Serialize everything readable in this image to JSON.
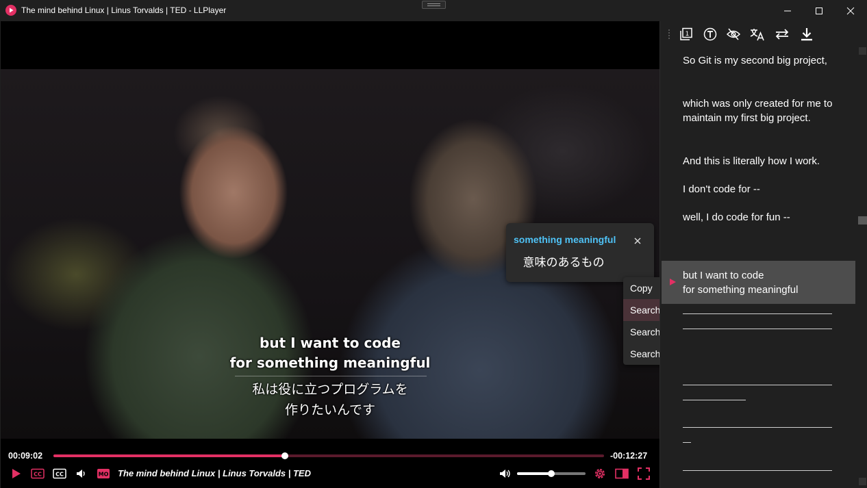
{
  "window": {
    "title": "The mind behind Linux | Linus Torvalds | TED - LLPlayer"
  },
  "subtitles_overlay": {
    "primary_line1": "but I want to code",
    "primary_line2": "for something meaningful",
    "secondary_line1": "私は役に立つプログラムを",
    "secondary_line2": "作りたいんです"
  },
  "word_popup": {
    "word": "something meaningful",
    "meaning": "意味のあるもの"
  },
  "context_menu": {
    "items": [
      "Copy",
      "Search Google",
      "Search Wiktionary",
      "Search Longman"
    ],
    "hovered": "Search Google"
  },
  "player": {
    "current_time": "00:09:02",
    "remaining_time": "-00:12:27",
    "progress": 0.421,
    "volume": 0.5,
    "media_title": "The mind behind Linux | Linus Torvalds | TED",
    "accent_color": "#e33064"
  },
  "sidebar": {
    "tools": [
      "single-subtitle-icon",
      "text-format-icon",
      "eye-off-icon",
      "translate-icon",
      "swap-icon",
      "download-icon"
    ],
    "items": [
      {
        "text": "So Git is my second big project,"
      },
      {
        "text": "which was only created for me to maintain my first big project."
      },
      {
        "text": "And this is literally how I work."
      },
      {
        "text": "I don't code for --"
      },
      {
        "text": "well, I do code for fun --"
      }
    ],
    "active_line1": "but I want to code",
    "active_line2": "for something meaningful"
  }
}
